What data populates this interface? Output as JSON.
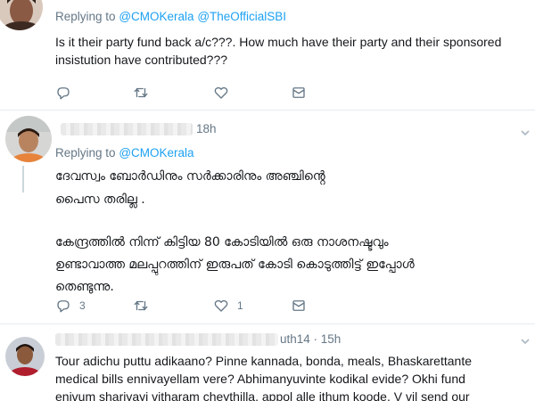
{
  "colors": {
    "link": "#1da1f2",
    "muted": "#657786",
    "text": "#14171a",
    "divider": "#e6ecf0"
  },
  "tweet1": {
    "replying_label": "Replying to",
    "mentions": [
      "@CMOKerala",
      "@TheOfficialSBI"
    ],
    "text_lines": [
      "Is it their party fund back a/c???. How much have their party and their sponsored",
      "insistution have contributed???"
    ],
    "actions": {
      "reply_count": "",
      "retweet_count": "",
      "like_count": ""
    }
  },
  "tweet2": {
    "time": "18h",
    "replying_label": "Replying to",
    "mentions": [
      "@CMOKerala"
    ],
    "text_lines": [
      "ദേവസ്വം ബോർഡിനും സർക്കാരിനും അഞ്ചിൻ്റെ",
      "പൈസ തരില്ല .",
      "",
      "കേന്ദ്രത്തിൽ നിന്ന്   കിട്ടിയ 80 കോടിയിൽ  ഒരു നാശനഷ്ടവും",
      "ഉണ്ടാവാത്ത മലപ്പുറത്തിന് ഇരുപത് കോടി കൊടുത്തിട്ട് ഇപ്പോൾ",
      "തെണ്ടുന്നു."
    ],
    "actions": {
      "reply_count": "3",
      "retweet_count": "",
      "like_count": "1"
    }
  },
  "tweet3": {
    "handle_tail": "uth14 · 15h",
    "text_lines": [
      "Tour adichu puttu adikaano? Pinne kannada, bonda, meals, Bhaskarettante",
      "medical bills ennivayellam vere? Abhimanyuvinte kodikal evide? Okhi fund",
      "enivum shariyayi vitharam cheythilla, appol alle ithum koode.  V vil send our"
    ]
  },
  "icons": [
    "reply-icon",
    "retweet-icon",
    "like-icon",
    "message-icon",
    "chevron-down-icon"
  ]
}
